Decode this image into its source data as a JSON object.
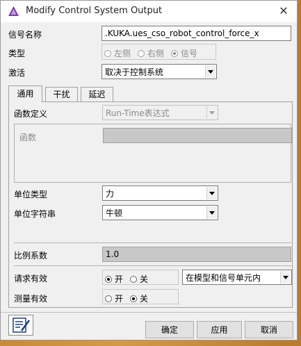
{
  "window": {
    "title": "Modify Control System Output",
    "close_glyph": "✕"
  },
  "signal_name": {
    "label": "信号名称",
    "value": ".KUKA.ues_cso_robot_control_force_x"
  },
  "type": {
    "label": "类型",
    "options": [
      "左侧",
      "右侧",
      "信号"
    ],
    "selected": "信号"
  },
  "activation": {
    "label": "激活",
    "value": "取决于控制系统"
  },
  "tabs": [
    "通用",
    "干扰",
    "延迟"
  ],
  "function_def": {
    "label": "函数定义",
    "value": "Run-Time表达式"
  },
  "function": {
    "label": "函数",
    "value": ""
  },
  "unit_type": {
    "label": "单位类型",
    "value": "力"
  },
  "unit_string": {
    "label": "单位字符串",
    "value": "牛顿"
  },
  "scale": {
    "label": "比例系数",
    "value": "1.0"
  },
  "request_valid": {
    "label": "请求有效",
    "on": "开",
    "off": "关",
    "selected": "开",
    "scope": "在模型和信号单元内"
  },
  "measure_valid": {
    "label": "测量有效",
    "on": "开",
    "off": "关",
    "selected": "关"
  },
  "buttons": {
    "ok": "确定",
    "apply": "应用",
    "cancel": "取消"
  },
  "icons": {
    "app": "app-logo-icon",
    "bottom": "edit-notes-icon",
    "dropdown": "chevron-down-icon"
  },
  "colors": {
    "disabled_field": "#c8c8c8",
    "dialog_bg": "#f0f0f0"
  }
}
